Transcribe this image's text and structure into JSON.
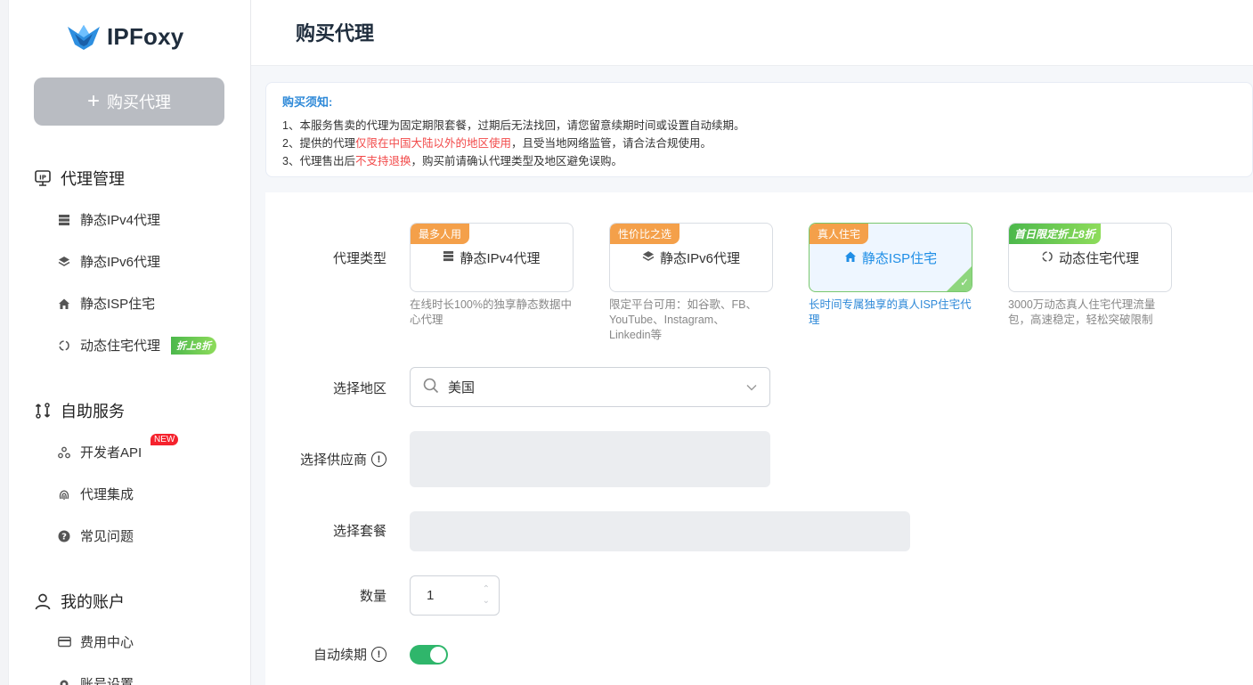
{
  "brand": {
    "name": "IPFoxy"
  },
  "sidebar": {
    "buy_button": "购买代理",
    "groups": [
      {
        "label": "代理管理",
        "items": [
          "静态IPv4代理",
          "静态IPv6代理",
          "静态ISP住宅",
          "动态住宅代理"
        ]
      },
      {
        "label": "自助服务",
        "items": [
          "开发者API",
          "代理集成",
          "常见问题"
        ]
      },
      {
        "label": "我的账户",
        "items": [
          "费用中心",
          "账号设置"
        ]
      }
    ],
    "badges": {
      "new": "NEW",
      "promo": "折上8折"
    }
  },
  "header": {
    "title": "购买代理"
  },
  "notice": {
    "title": "购买须知:",
    "line1": "1、本服务售卖的代理为固定期限套餐，过期后无法找回，请您留意续期时间或设置自动续期。",
    "line2_a": "2、提供的代理",
    "line2_red": "仅限在中国大陆以外的地区使用",
    "line2_b": "，且受当地网络监管，请合法合规使用。",
    "line3_a": "3、代理售出后",
    "line3_red": "不支持退换",
    "line3_b": "，购买前请确认代理类型及地区避免误购。"
  },
  "form": {
    "type_label": "代理类型",
    "region_label": "选择地区",
    "region_value": "美国",
    "supplier_label": "选择供应商",
    "package_label": "选择套餐",
    "quantity_label": "数量",
    "quantity_value": "1",
    "auto_renew_label": "自动续期",
    "auto_renew_on": true,
    "cards": [
      {
        "tag": "最多人用",
        "name": "静态IPv4代理",
        "desc": "在线时长100%的独享静态数据中心代理"
      },
      {
        "tag": "性价比之选",
        "name": "静态IPv6代理",
        "desc": "限定平台可用：如谷歌、FB、YouTube、Instagram、Linkedin等"
      },
      {
        "tag": "真人住宅",
        "name": "静态ISP住宅",
        "desc": "长时间专属独享的真人ISP住宅代理",
        "selected": true
      },
      {
        "tag": "首日限定折上8折",
        "name": "动态住宅代理",
        "desc": "3000万动态真人住宅代理流量包，高速稳定，轻松突破限制"
      }
    ]
  },
  "colors": {
    "accent": "#2e89d8",
    "warning": "#f24a4a",
    "toggle_on": "#2fb66b",
    "tag_orange": "#f4a04a"
  }
}
